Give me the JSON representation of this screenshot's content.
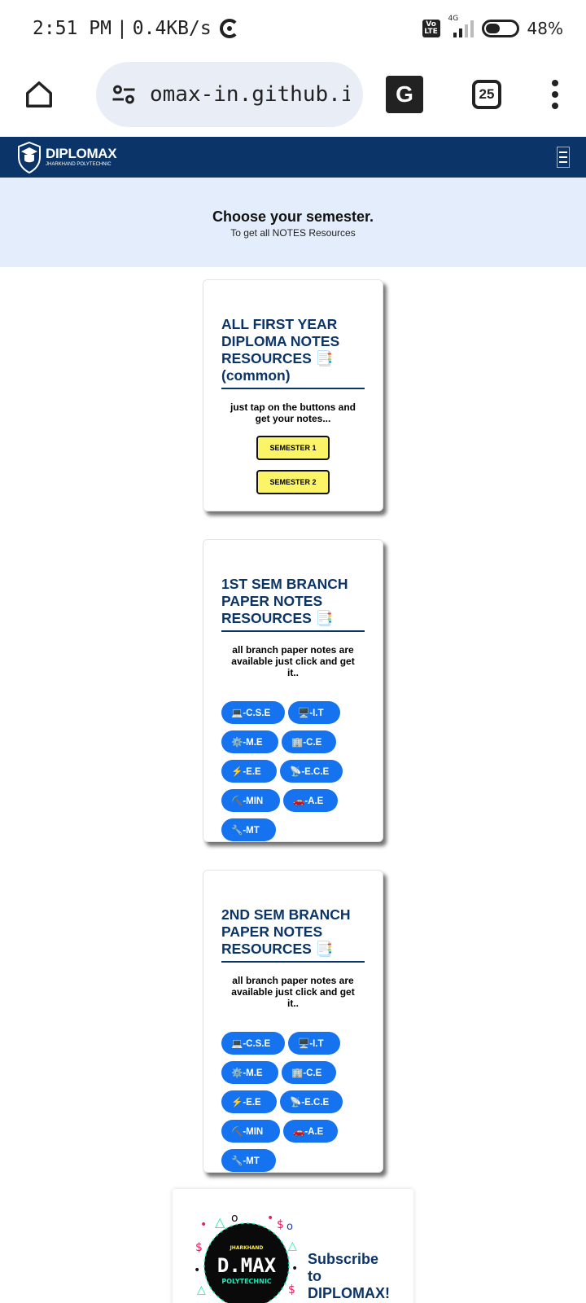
{
  "status": {
    "time": "2:51 PM",
    "speed": "0.4KB/s",
    "network": "4G",
    "volte": "Vo LTE",
    "battery": "48%",
    "battery_level": 0.48
  },
  "browser": {
    "url": "omax-in.github.io",
    "tab_count": "25"
  },
  "nav": {
    "brand_name": "DIPLOMAX",
    "brand_sub": "JHARKHAND POLYTECHNIC"
  },
  "hero": {
    "title": "Choose your semester.",
    "subtitle": "To get all NOTES Resources"
  },
  "cards": [
    {
      "title": "ALL FIRST YEAR DIPLOMA NOTES RESOURCES 📑 (common)",
      "text": "just tap on the buttons and get your notes...",
      "buttons": [
        "SEMESTER 1",
        "SEMESTER 2"
      ]
    },
    {
      "title": "1ST SEM BRANCH PAPER NOTES RESOURCES 📑",
      "text": "all branch paper notes are available just click and get it..",
      "branches": [
        "💻-C.S.E",
        "🖥️-I.T",
        "⚙️-M.E",
        "🏢-C.E",
        "⚡-E.E",
        "📡-E.C.E",
        "⛏️-MIN",
        "🚗-A.E",
        "🔧-MT"
      ]
    },
    {
      "title": "2ND SEM BRANCH PAPER NOTES RESOURCES 📑",
      "text": "all branch paper notes are available just click and get it..",
      "branches": [
        "💻-C.S.E",
        "🖥️-I.T",
        "⚙️-M.E",
        "🏢-C.E",
        "⚡-E.E",
        "📡-E.C.E",
        "⛏️-MIN",
        "🚗-A.E",
        "🔧-MT"
      ]
    }
  ],
  "subscribe": {
    "title": "Subscribe to DIPLOMAX!",
    "logo_top": "JHARKHAND",
    "logo_main": "D.MAX",
    "logo_bottom": "POLYTECHNIC"
  }
}
